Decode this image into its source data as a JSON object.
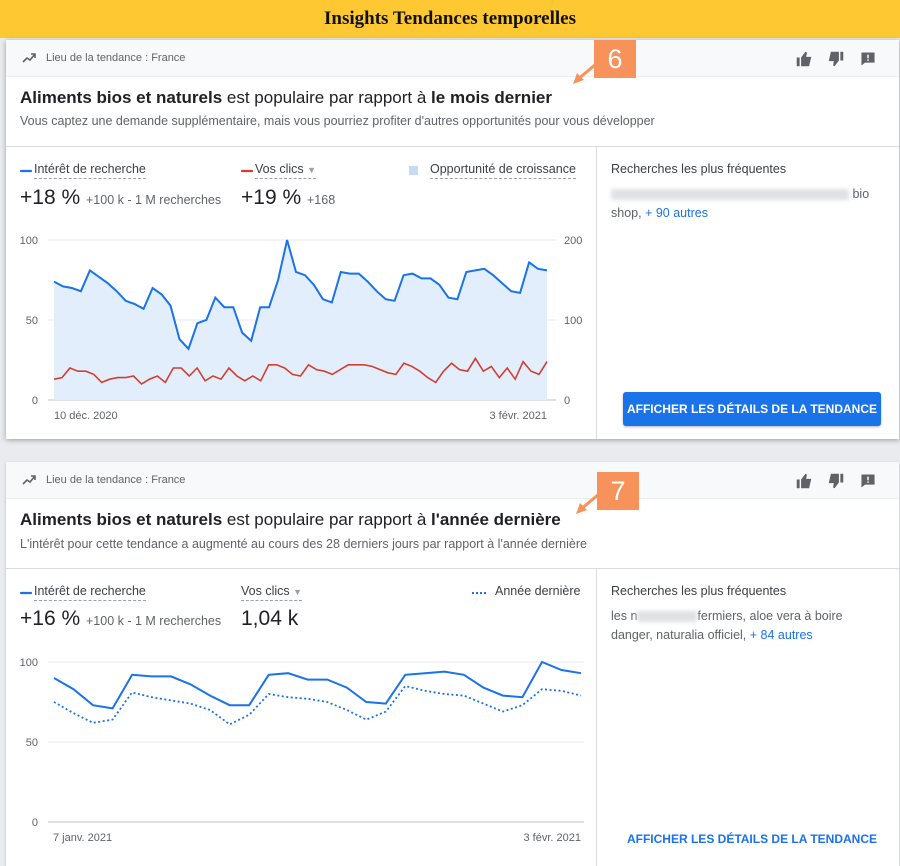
{
  "banner": {
    "title": "Insights Tendances temporelles"
  },
  "colors": {
    "accent": "#1a73e8",
    "clicks": "#d23f31",
    "badge": "#f7935a",
    "banner": "#fec832"
  },
  "cards": [
    {
      "badge": "6",
      "location": "Lieu de la tendance : France",
      "title": {
        "subject": "Aliments bios et naturels",
        "middle": "est populaire par rapport à",
        "period": "le mois dernier"
      },
      "subtitle": "Vous captez une demande supplémentaire, mais vous pourriez profiter d'autres opportunités pour vous développer",
      "legend": {
        "interest": "Intérêt de recherche",
        "clicks": "Vos clics",
        "third": "Opportunité de croissance"
      },
      "metrics": {
        "interest_value": "+18 %",
        "interest_sub": "+100 k - 1 M recherches",
        "clicks_value": "+19 %",
        "clicks_sub": "+168"
      },
      "side": {
        "title": "Recherches les plus fréquentes",
        "pre": "",
        "post": "bio",
        "line2": "shop,",
        "more": "+ 90 autres"
      },
      "button": "AFFICHER LES DÉTAILS DE LA TENDANCE"
    },
    {
      "badge": "7",
      "location": "Lieu de la tendance : France",
      "title": {
        "subject": "Aliments bios et naturels",
        "middle": "est populaire par rapport à",
        "period": "l'année dernière"
      },
      "subtitle": "L'intérêt pour cette tendance a augmenté au cours des 28 derniers jours par rapport à l'année dernière",
      "legend": {
        "interest": "Intérêt de recherche",
        "clicks": "Vos clics",
        "third": "Année dernière"
      },
      "metrics": {
        "interest_value": "+16 %",
        "interest_sub": "+100 k - 1 M recherches",
        "clicks_value": "1,04 k"
      },
      "side": {
        "title": "Recherches les plus fréquentes",
        "pre": "les n",
        "post": "fermiers, aloe vera à boire",
        "line2": "danger, naturalia officiel,",
        "more": "+ 84 autres"
      },
      "button": "AFFICHER LES DÉTAILS DE LA TENDANCE"
    }
  ],
  "chart_data": [
    {
      "type": "line",
      "x_start": "10 déc. 2020",
      "x_end": "3 févr. 2021",
      "x_tick_labels": [
        "10 déc. 2020",
        "3 févr. 2021"
      ],
      "y_left_ticks": [
        "100",
        "50",
        "0"
      ],
      "y_right_ticks": [
        "200",
        "100",
        "0"
      ],
      "ylim_left": [
        0,
        100
      ],
      "ylim_right": [
        0,
        200
      ],
      "series": [
        {
          "name": "Intérêt de recherche",
          "axis": "left",
          "area": true,
          "values": [
            74,
            71,
            70,
            68,
            81,
            77,
            73,
            68,
            62,
            60,
            57,
            70,
            66,
            59,
            38,
            32,
            48,
            50,
            64,
            58,
            58,
            42,
            37,
            58,
            58,
            75,
            100,
            80,
            78,
            72,
            63,
            61,
            80,
            79,
            79,
            74,
            68,
            63,
            62,
            78,
            79,
            76,
            76,
            72,
            64,
            63,
            80,
            81,
            82,
            78,
            73,
            68,
            67,
            86,
            82,
            81
          ]
        },
        {
          "name": "Vos clics",
          "axis": "right",
          "values": [
            26,
            28,
            40,
            36,
            36,
            32,
            22,
            26,
            28,
            28,
            30,
            20,
            26,
            30,
            22,
            40,
            40,
            30,
            40,
            24,
            30,
            26,
            40,
            30,
            24,
            30,
            24,
            44,
            44,
            40,
            32,
            30,
            44,
            38,
            36,
            32,
            38,
            44,
            44,
            44,
            42,
            38,
            34,
            32,
            46,
            42,
            36,
            28,
            22,
            36,
            46,
            38,
            36,
            52,
            36,
            42,
            28,
            40,
            26,
            48,
            36,
            32,
            48
          ]
        }
      ],
      "grid": true
    },
    {
      "type": "line",
      "x_start": "7 janv. 2021",
      "x_end": "3 févr. 2021",
      "x_tick_labels": [
        "7 janv. 2021",
        "3 févr. 2021"
      ],
      "y_left_ticks": [
        "100",
        "50",
        "0"
      ],
      "ylim_left": [
        0,
        100
      ],
      "series": [
        {
          "name": "Intérêt de recherche",
          "style": "solid",
          "values": [
            90,
            83,
            73,
            71,
            92,
            91,
            91,
            86,
            79,
            73,
            73,
            92,
            93,
            89,
            89,
            84,
            75,
            74,
            92,
            93,
            94,
            92,
            84,
            79,
            78,
            100,
            95,
            93
          ]
        },
        {
          "name": "Année dernière",
          "style": "dotted",
          "values": [
            75,
            68,
            62,
            64,
            81,
            78,
            76,
            74,
            70,
            61,
            67,
            80,
            78,
            77,
            75,
            70,
            64,
            69,
            85,
            82,
            80,
            79,
            74,
            69,
            73,
            83,
            82,
            79
          ]
        }
      ],
      "grid": true
    }
  ]
}
